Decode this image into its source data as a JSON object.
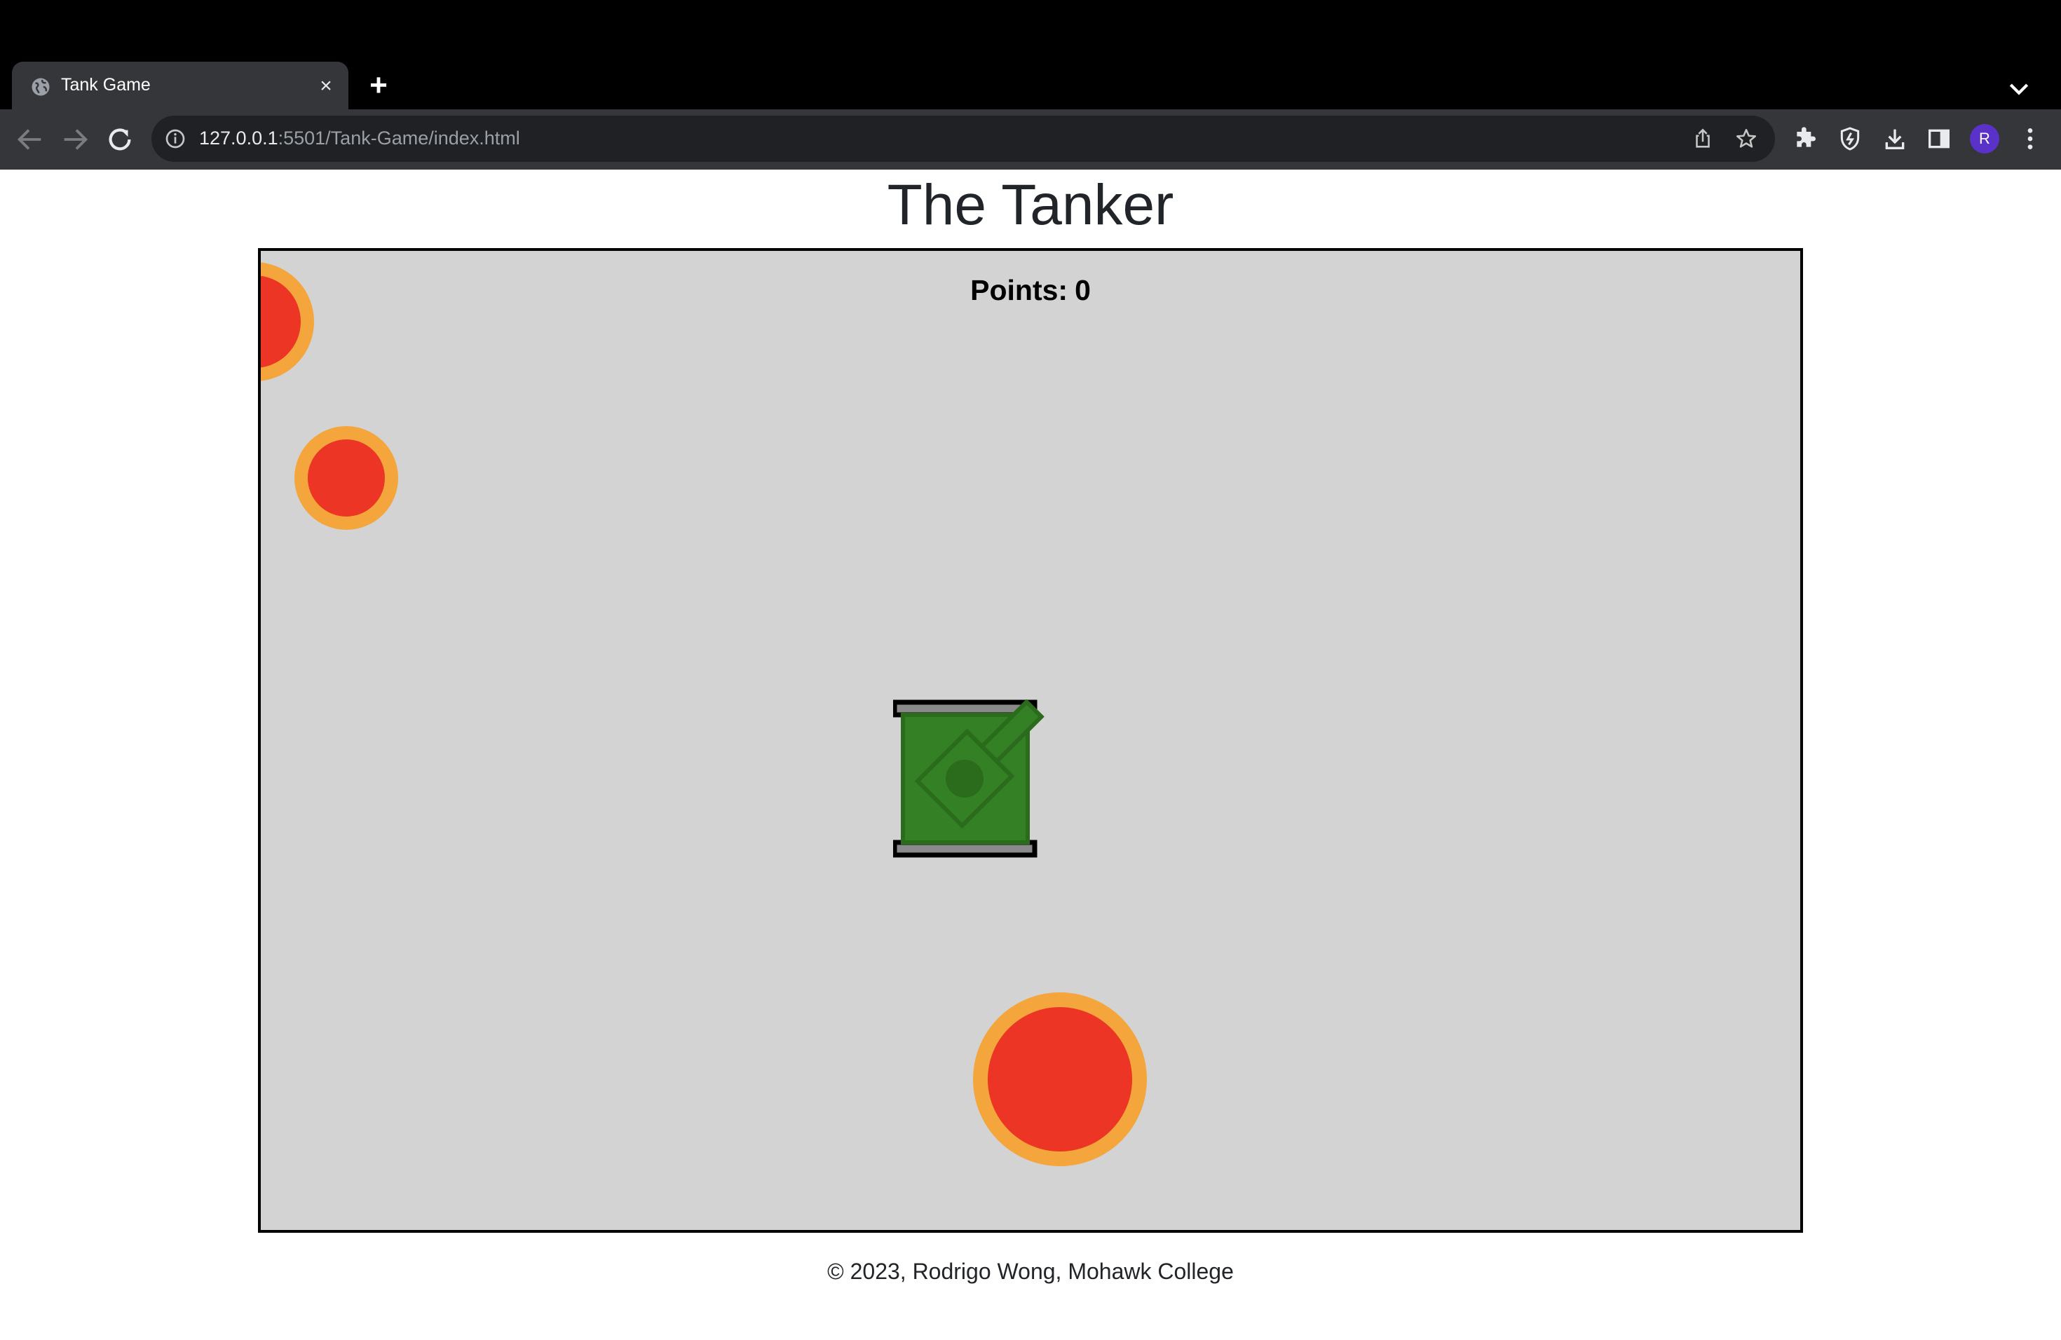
{
  "browser": {
    "tab_title": "Tank Game",
    "new_tab_symbol": "+",
    "close_symbol": "×",
    "url_host": "127.0.0.1",
    "url_path": ":5501/Tank-Game/index.html",
    "profile_initial": "R",
    "profile_color": "#5b32c9",
    "icons": [
      "globe-icon",
      "back-icon",
      "forward-icon",
      "reload-icon",
      "info-icon",
      "share-icon",
      "star-icon",
      "extensions-icon",
      "sync-icon",
      "download-icon",
      "side-panel-icon",
      "menu-icon",
      "chevron-down-icon"
    ]
  },
  "page": {
    "title": "The Tanker",
    "points_label": "Points:",
    "points_value": "0",
    "footer": "© 2023, Rodrigo Wong, Mohawk College"
  },
  "colors": {
    "board_background": "#d3d3d3",
    "enemy_fill": "#ec3524",
    "enemy_ring": "#f4a53c",
    "tank_body": "#348024",
    "tank_dark": "#2a6b1c",
    "tread": "#8a8a8a"
  }
}
